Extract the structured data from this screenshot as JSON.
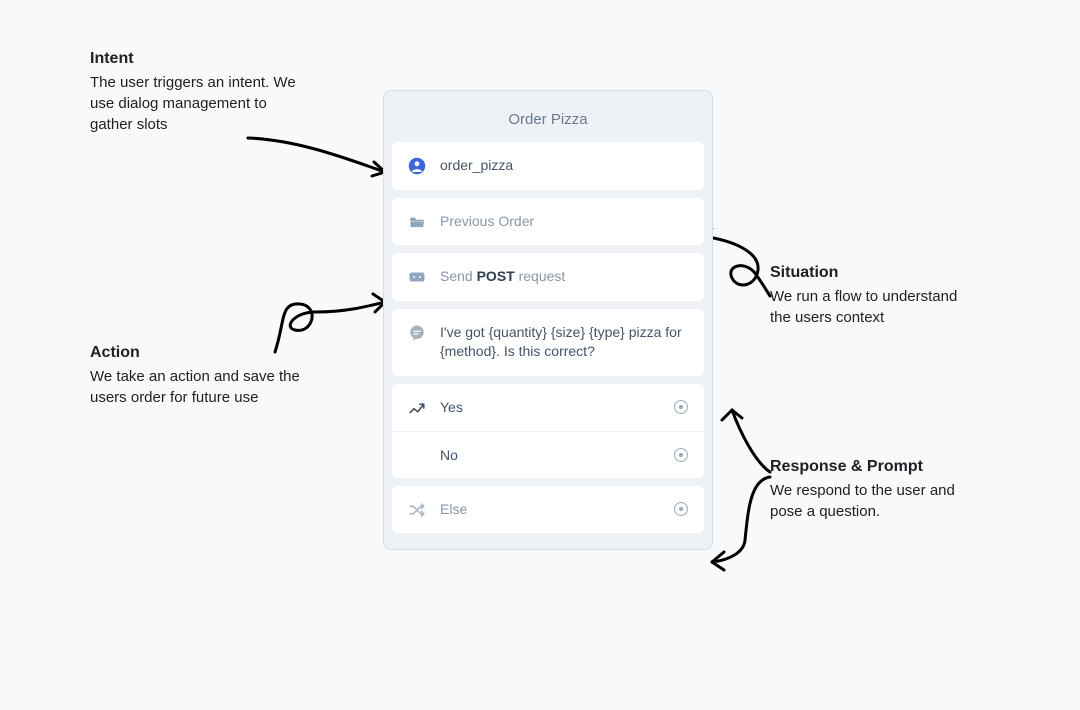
{
  "annotations": {
    "intent": {
      "title": "Intent",
      "body": "The user triggers an intent. We use dialog management to gather slots"
    },
    "action": {
      "title": "Action",
      "body": "We take an action and save the users order for future use"
    },
    "situation": {
      "title": "Situation",
      "body": "We run a flow to understand the users context"
    },
    "response": {
      "title": "Response & Prompt",
      "body": "We respond to the user and pose a question."
    }
  },
  "panel": {
    "title": "Order Pizza",
    "cards": {
      "intent": "order_pizza",
      "flow": "Previous Order",
      "action_prefix": "Send ",
      "action_bold": "POST",
      "action_suffix": " request",
      "message": "I've got {quantity} {size} {type} pizza for {method}. Is this correct?"
    },
    "branches": {
      "yes": "Yes",
      "no": "No",
      "else": "Else"
    }
  }
}
